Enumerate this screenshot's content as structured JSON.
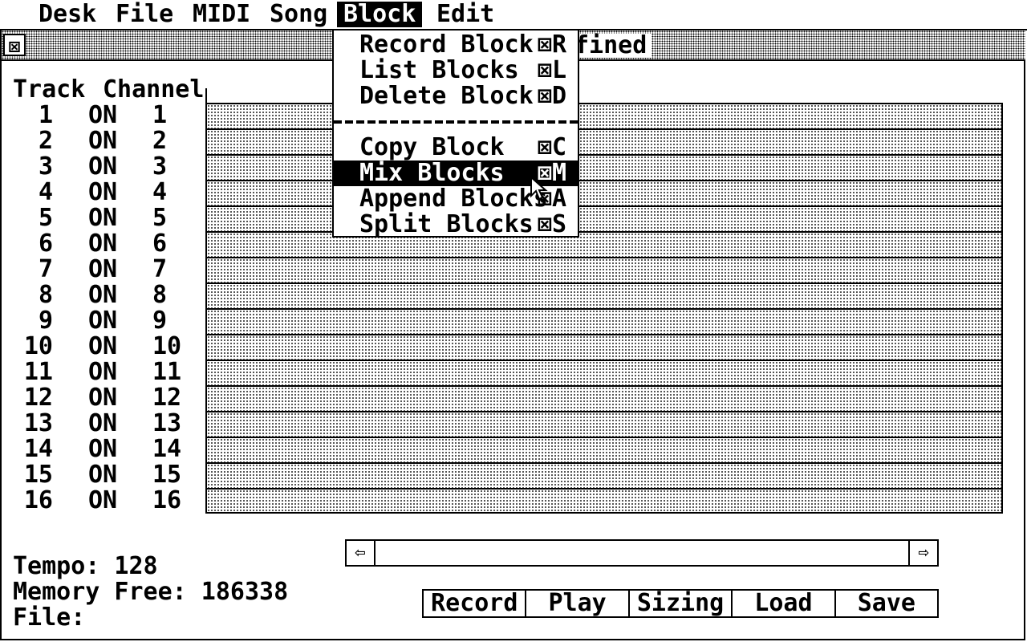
{
  "menubar": {
    "items": [
      {
        "label": "Desk"
      },
      {
        "label": "File"
      },
      {
        "label": "MIDI"
      },
      {
        "label": "Song"
      },
      {
        "label": "Block"
      },
      {
        "label": "Edit"
      }
    ],
    "active": "Block"
  },
  "window": {
    "close_glyph": "⊠",
    "title_visible": "fined"
  },
  "tracks": {
    "header_track": "Track",
    "header_channel": "Channel",
    "rows": [
      {
        "track": "1",
        "state": "ON",
        "channel": "1"
      },
      {
        "track": "2",
        "state": "ON",
        "channel": "2"
      },
      {
        "track": "3",
        "state": "ON",
        "channel": "3"
      },
      {
        "track": "4",
        "state": "ON",
        "channel": "4"
      },
      {
        "track": "5",
        "state": "ON",
        "channel": "5"
      },
      {
        "track": "6",
        "state": "ON",
        "channel": "6"
      },
      {
        "track": "7",
        "state": "ON",
        "channel": "7"
      },
      {
        "track": "8",
        "state": "ON",
        "channel": "8"
      },
      {
        "track": "9",
        "state": "ON",
        "channel": "9"
      },
      {
        "track": "10",
        "state": "ON",
        "channel": "10"
      },
      {
        "track": "11",
        "state": "ON",
        "channel": "11"
      },
      {
        "track": "12",
        "state": "ON",
        "channel": "12"
      },
      {
        "track": "13",
        "state": "ON",
        "channel": "13"
      },
      {
        "track": "14",
        "state": "ON",
        "channel": "14"
      },
      {
        "track": "15",
        "state": "ON",
        "channel": "15"
      },
      {
        "track": "16",
        "state": "ON",
        "channel": "16"
      }
    ]
  },
  "scrollbar": {
    "left_glyph": "⇦",
    "right_glyph": "⇨"
  },
  "status": {
    "tempo": "Tempo: 128",
    "memory": "Memory Free: 186338",
    "file": "File:"
  },
  "buttons": [
    "Record",
    "Play",
    "Sizing",
    "Load",
    "Save"
  ],
  "block_menu": {
    "items": [
      {
        "label": "Record Block",
        "shortcut": "⊠R"
      },
      {
        "label": "List Blocks",
        "shortcut": "⊠L"
      },
      {
        "label": "Delete Block",
        "shortcut": "⊠D"
      },
      {
        "label": "Copy Block",
        "shortcut": "⊠C"
      },
      {
        "label": "Mix Blocks",
        "shortcut": "⊠M"
      },
      {
        "label": "Append Blocks",
        "shortcut": "⊠A"
      },
      {
        "label": "Split Blocks",
        "shortcut": "⊠S"
      }
    ],
    "highlighted": "Mix Blocks"
  }
}
